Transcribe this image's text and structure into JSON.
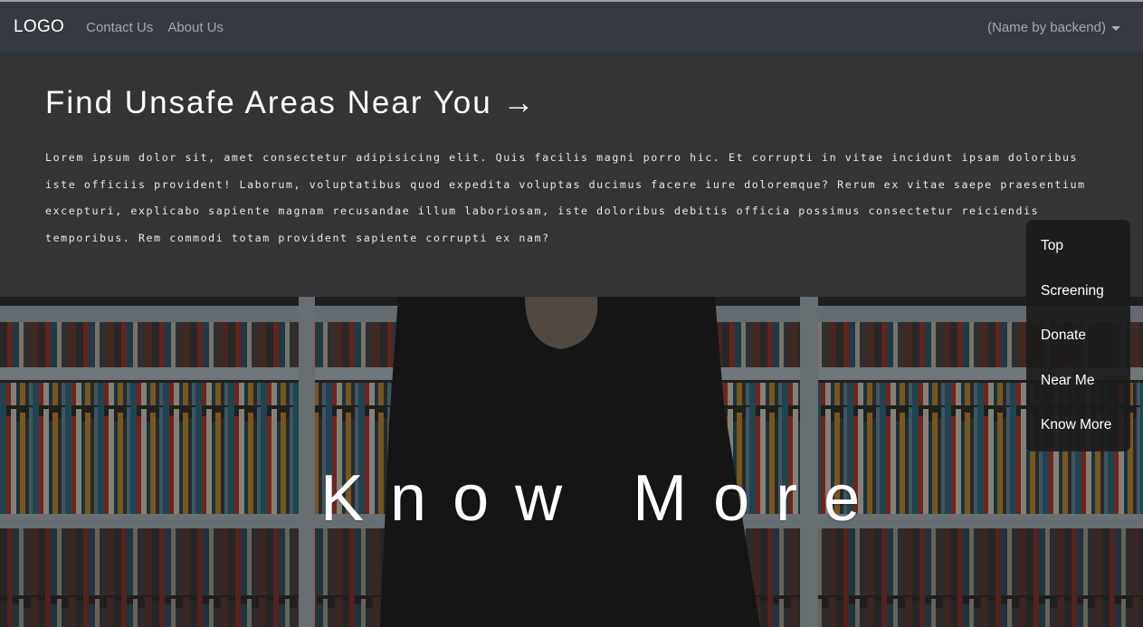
{
  "navbar": {
    "logo": "LOGO",
    "links": [
      "Contact Us",
      "About Us"
    ],
    "user_menu": "(Name by backend)"
  },
  "intro": {
    "title": "Find Unsafe Areas Near You",
    "title_arrow": "→",
    "body": "Lorem ipsum dolor sit, amet consectetur adipisicing elit. Quis facilis magni porro hic. Et corrupti in vitae incidunt ipsam doloribus iste officiis provident! Laborum, voluptatibus quod expedita voluptas ducimus facere iure doloremque? Rerum ex vitae saepe praesentium excepturi, explicabo sapiente magnam recusandae illum laboriosam, iste doloribus debitis officia possimus consectetur reiciendis temporibus. Rem commodi totam provident sapiente corrupti ex nam?"
  },
  "hero": {
    "title": "Know More"
  },
  "side_menu": {
    "items": [
      "Top",
      "Screening",
      "Donate",
      "Near Me",
      "Know More"
    ]
  },
  "colors": {
    "navbar_bg": "#343a40",
    "intro_bg": "#343434",
    "side_menu_bg": "#1c1c1c",
    "text": "#ffffff"
  }
}
